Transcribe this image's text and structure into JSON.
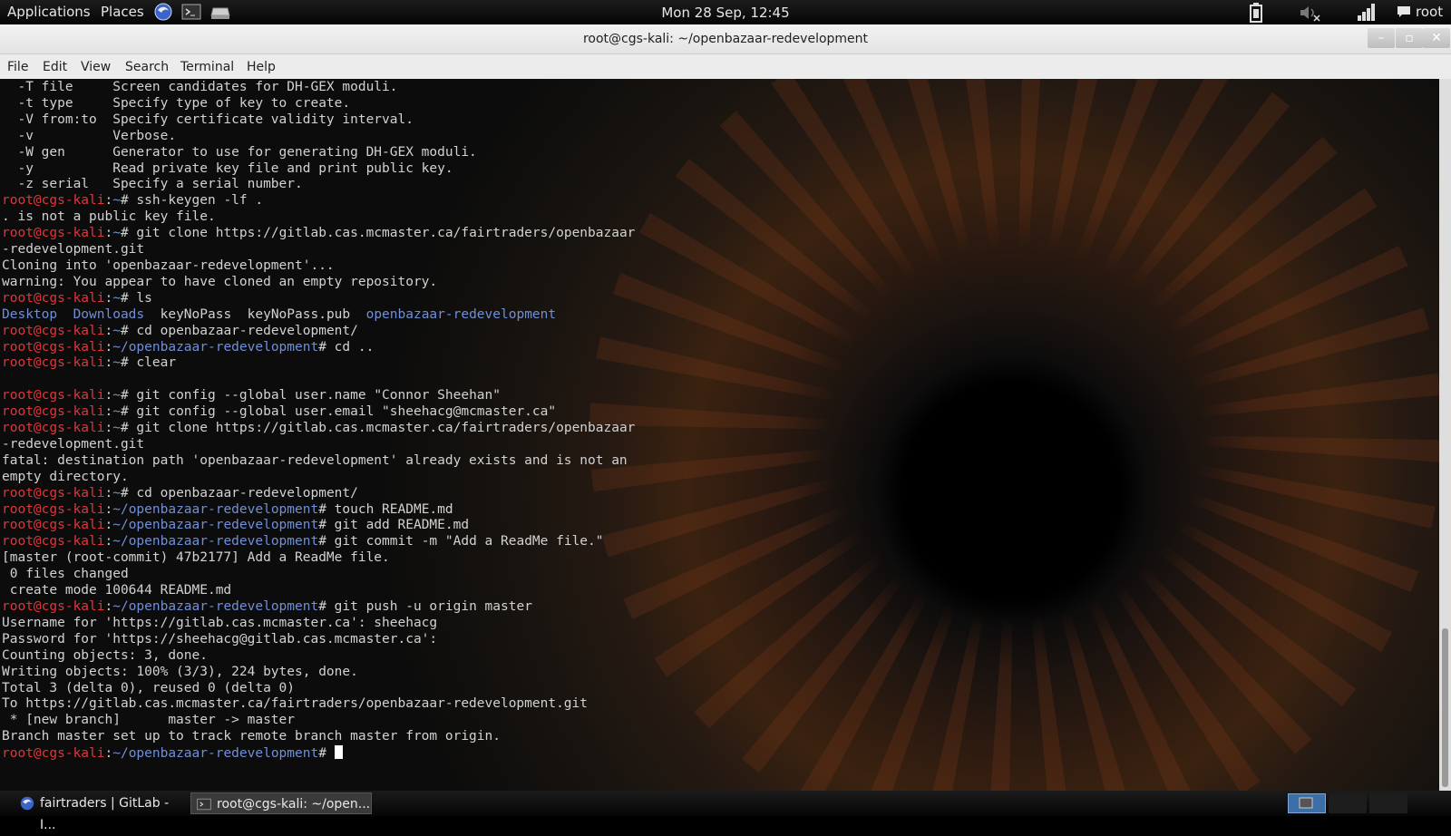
{
  "top_panel": {
    "applications": "Applications",
    "places": "Places",
    "clock": "Mon 28 Sep, 12:45",
    "user": "root",
    "launchers": [
      "browser-icon",
      "terminal-icon",
      "drive-icon"
    ],
    "indicators": [
      "battery-icon",
      "volume-muted-icon",
      "network-signal-icon",
      "chat-bubble-icon"
    ]
  },
  "window": {
    "title": "root@cgs-kali: ~/openbazaar-redevelopment",
    "buttons": [
      "minimize",
      "maximize",
      "close"
    ]
  },
  "menubar": [
    "File",
    "Edit",
    "View",
    "Search",
    "Terminal",
    "Help"
  ],
  "terminal": {
    "prompt_user": "root@cgs-kali",
    "lines": [
      {
        "t": "  -T file     Screen candidates for DH-GEX moduli."
      },
      {
        "t": "  -t type     Specify type of key to create."
      },
      {
        "t": "  -V from:to  Specify certificate validity interval."
      },
      {
        "t": "  -v          Verbose."
      },
      {
        "t": "  -W gen      Generator to use for generating DH-GEX moduli."
      },
      {
        "t": "  -y          Read private key file and print public key."
      },
      {
        "t": "  -z serial   Specify a serial number."
      },
      {
        "p": "~",
        "c": "ssh-keygen -lf ."
      },
      {
        "t": ". is not a public key file."
      },
      {
        "p": "~",
        "c": "git clone https://gitlab.cas.mcmaster.ca/fairtraders/openbazaar"
      },
      {
        "t": "-redevelopment.git"
      },
      {
        "t": "Cloning into 'openbazaar-redevelopment'..."
      },
      {
        "t": "warning: You appear to have cloned an empty repository."
      },
      {
        "p": "~",
        "c": "ls"
      },
      {
        "ls": [
          [
            "Desktop",
            "dir"
          ],
          [
            "  ",
            ""
          ],
          [
            "Downloads",
            "dir"
          ],
          [
            "  keyNoPass  keyNoPass.pub  ",
            ""
          ],
          [
            "openbazaar-redevelopment",
            "dir"
          ]
        ]
      },
      {
        "p": "~",
        "c": "cd openbazaar-redevelopment/"
      },
      {
        "p": "~/openbazaar-redevelopment",
        "c": "cd .."
      },
      {
        "p": "~",
        "c": "clear"
      },
      {
        "t": ""
      },
      {
        "p": "~",
        "c": "git config --global user.name \"Connor Sheehan\""
      },
      {
        "p": "~",
        "c": "git config --global user.email \"sheehacg@mcmaster.ca\""
      },
      {
        "p": "~",
        "c": "git clone https://gitlab.cas.mcmaster.ca/fairtraders/openbazaar"
      },
      {
        "t": "-redevelopment.git"
      },
      {
        "t": "fatal: destination path 'openbazaar-redevelopment' already exists and is not an"
      },
      {
        "t": "empty directory."
      },
      {
        "p": "~",
        "c": "cd openbazaar-redevelopment/"
      },
      {
        "p": "~/openbazaar-redevelopment",
        "c": "touch README.md"
      },
      {
        "p": "~/openbazaar-redevelopment",
        "c": "git add README.md"
      },
      {
        "p": "~/openbazaar-redevelopment",
        "c": "git commit -m \"Add a ReadMe file.\""
      },
      {
        "t": "[master (root-commit) 47b2177] Add a ReadMe file."
      },
      {
        "t": " 0 files changed"
      },
      {
        "t": " create mode 100644 README.md"
      },
      {
        "p": "~/openbazaar-redevelopment",
        "c": "git push -u origin master"
      },
      {
        "t": "Username for 'https://gitlab.cas.mcmaster.ca': sheehacg"
      },
      {
        "t": "Password for 'https://sheehacg@gitlab.cas.mcmaster.ca':"
      },
      {
        "t": "Counting objects: 3, done."
      },
      {
        "t": "Writing objects: 100% (3/3), 224 bytes, done."
      },
      {
        "t": "Total 3 (delta 0), reused 0 (delta 0)"
      },
      {
        "t": "To https://gitlab.cas.mcmaster.ca/fairtraders/openbazaar-redevelopment.git"
      },
      {
        "t": " * [new branch]      master -> master"
      },
      {
        "t": "Branch master set up to track remote branch master from origin."
      },
      {
        "p": "~/openbazaar-redevelopment",
        "c": "",
        "cursor": true
      }
    ]
  },
  "taskbar": {
    "tasks": [
      {
        "label": "fairtraders | GitLab - I...",
        "icon": "browser-icon"
      },
      {
        "label": "root@cgs-kali: ~/open...",
        "icon": "terminal-icon"
      }
    ]
  },
  "colors": {
    "prompt_user": "#e0363a",
    "prompt_path": "#6f8fd8",
    "directory": "#6f8fd8",
    "terminal_text": "#d2d2d2"
  }
}
